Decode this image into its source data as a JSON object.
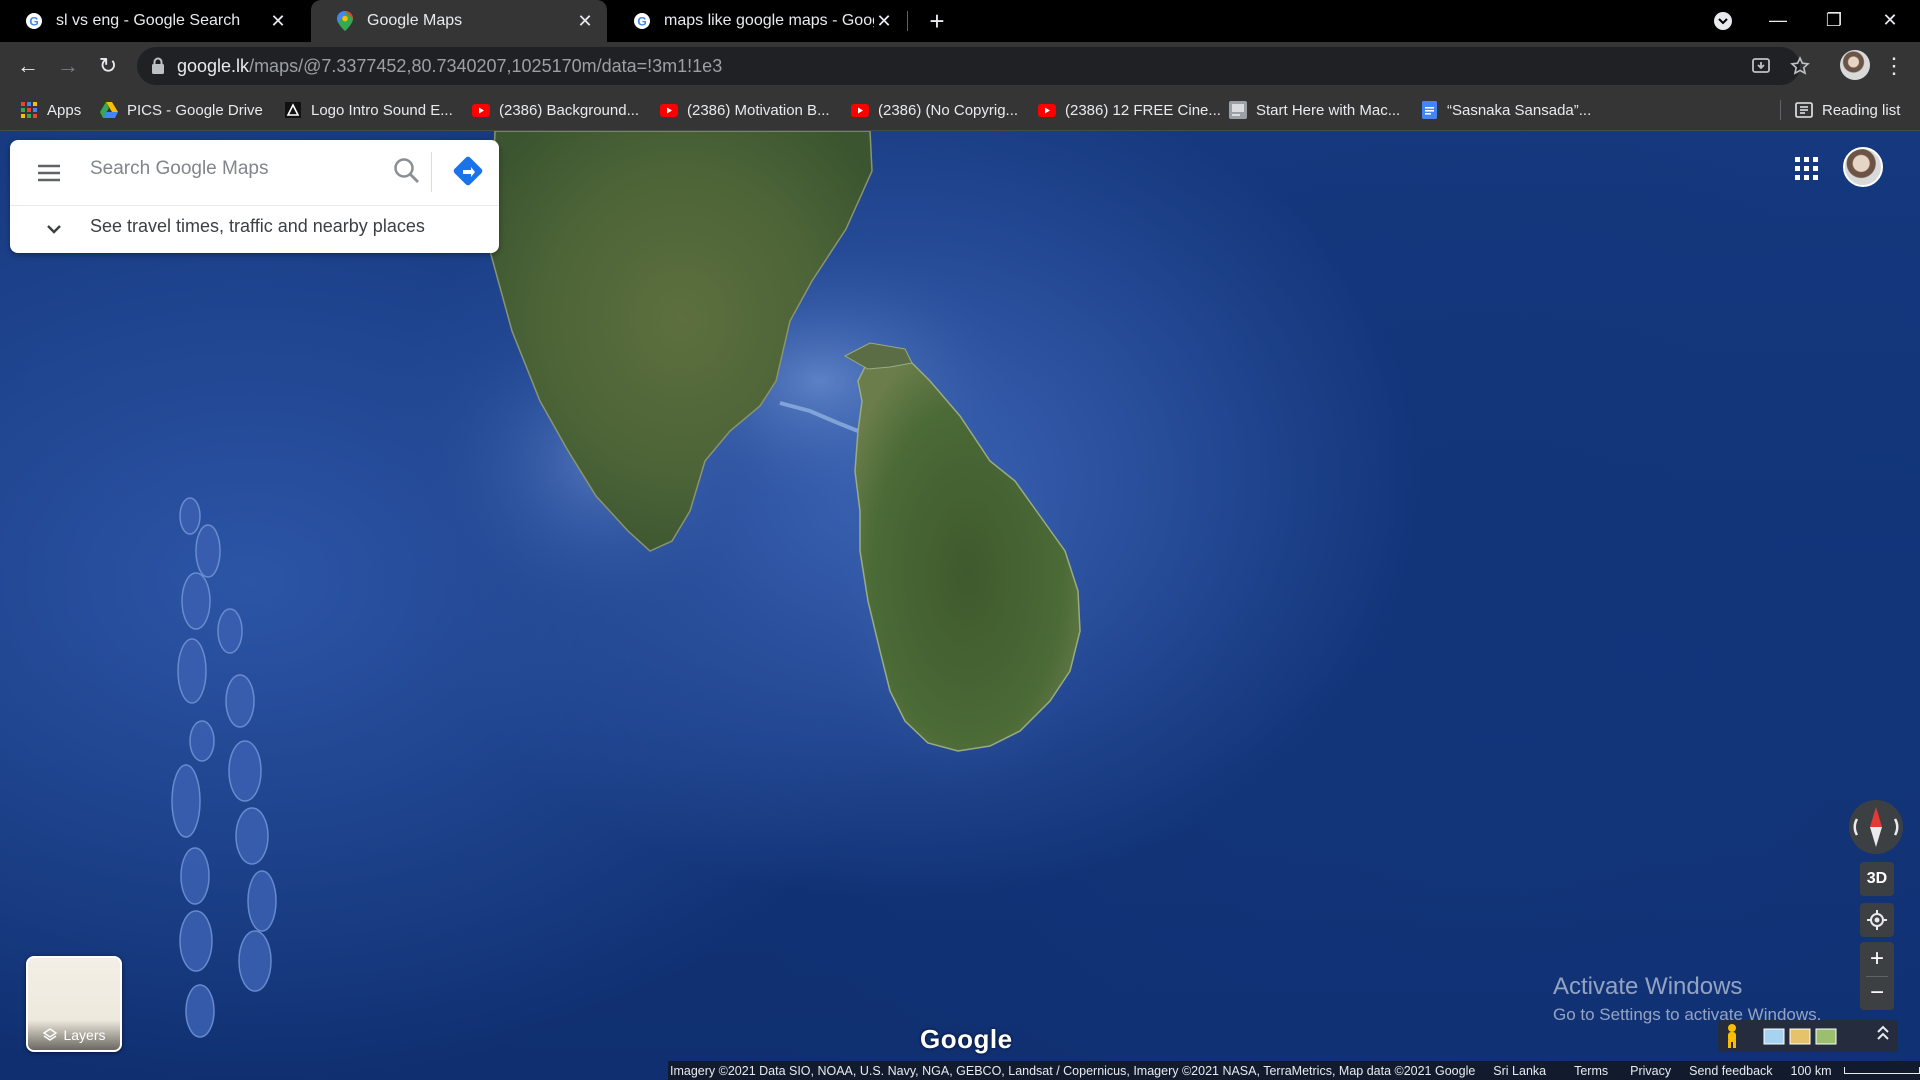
{
  "tabs": [
    {
      "title": "sl vs eng - Google Search",
      "icon": "google-g-icon",
      "active": false
    },
    {
      "title": "Google Maps",
      "icon": "google-maps-pin-icon",
      "active": true
    },
    {
      "title": "maps like google maps - Google",
      "icon": "google-g-icon",
      "active": false
    }
  ],
  "toolbar": {
    "url_domain": "google.lk",
    "url_path": "/maps/@7.3377452,80.7340207,1025170m/data=!3m1!1e3"
  },
  "bookmarks": [
    {
      "label": "Apps",
      "icon": "apps-grid-icon"
    },
    {
      "label": "PICS - Google Drive",
      "icon": "google-drive-icon"
    },
    {
      "label": "Logo Intro Sound E...",
      "icon": "triangle-logo-icon"
    },
    {
      "label": "(2386) Background...",
      "icon": "youtube-icon"
    },
    {
      "label": "(2386) Motivation B...",
      "icon": "youtube-icon"
    },
    {
      "label": "(2386) (No Copyrig...",
      "icon": "youtube-icon"
    },
    {
      "label": "(2386) 12 FREE Cine...",
      "icon": "youtube-icon"
    },
    {
      "label": "Start Here with Mac...",
      "icon": "page-thumbnail-icon"
    },
    {
      "label": "“Sasnaka Sansada”...",
      "icon": "google-docs-icon"
    }
  ],
  "reading_list": "Reading list",
  "map": {
    "search_placeholder": "Search Google Maps",
    "travel_prompt": "See travel times, traffic and nearby places",
    "layers_label": "Layers",
    "three_d_label": "3D",
    "logo_text": "Google",
    "activate_title": "Activate Windows",
    "activate_sub": "Go to Settings to activate Windows.",
    "attribution": "Imagery ©2021 Data SIO, NOAA, U.S. Navy, NGA, GEBCO, Landsat / Copernicus, Imagery ©2021 NASA, TerraMetrics, Map data ©2021 Google",
    "region": "Sri Lanka",
    "terms": "Terms",
    "privacy": "Privacy",
    "feedback": "Send feedback",
    "scale": "100 km"
  },
  "colors": {
    "chrome_bg": "#000000",
    "toolbar_bg": "#353535",
    "ocean": "#16397f",
    "land": "#4e6b3a"
  }
}
